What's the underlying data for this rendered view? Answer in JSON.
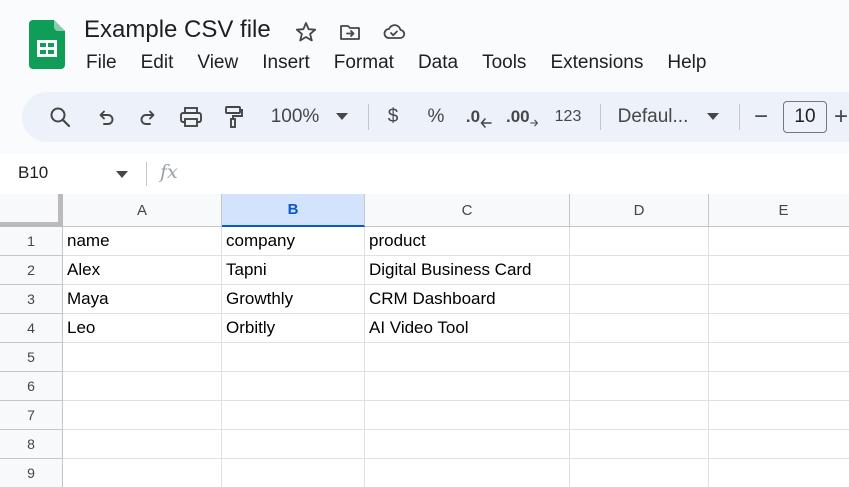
{
  "document": {
    "title": "Example CSV file"
  },
  "menu": [
    "File",
    "Edit",
    "View",
    "Insert",
    "Format",
    "Data",
    "Tools",
    "Extensions",
    "Help"
  ],
  "toolbar": {
    "zoom": "100%",
    "currency": "$",
    "percent": "%",
    "decrease_decimal": ".0",
    "increase_decimal": ".00",
    "number_format": "123",
    "font": "Defaul...",
    "font_size": "10",
    "minus": "−",
    "plus": "+"
  },
  "formula_bar": {
    "name_box": "B10",
    "fx": "fx"
  },
  "grid": {
    "columns": [
      "A",
      "B",
      "C",
      "D",
      "E"
    ],
    "selected_column": "B",
    "rows": [
      "1",
      "2",
      "3",
      "4",
      "5",
      "6",
      "7",
      "8",
      "9"
    ],
    "cells": [
      [
        "name",
        "company",
        "product",
        "",
        ""
      ],
      [
        "Alex",
        "Tapni",
        "Digital Business Card",
        "",
        ""
      ],
      [
        "Maya",
        "Growthly",
        "CRM Dashboard",
        "",
        ""
      ],
      [
        "Leo",
        "Orbitly",
        "AI Video Tool",
        "",
        ""
      ],
      [
        "",
        "",
        "",
        "",
        ""
      ],
      [
        "",
        "",
        "",
        "",
        ""
      ],
      [
        "",
        "",
        "",
        "",
        ""
      ],
      [
        "",
        "",
        "",
        "",
        ""
      ],
      [
        "",
        "",
        "",
        "",
        ""
      ]
    ]
  },
  "colors": {
    "brand_green": "#0f9d58",
    "selected_header_bg": "#d3e3fd",
    "selected_header_text": "#0b57d0",
    "toolbar_bg": "#edf2fa"
  },
  "icons": [
    "sheets-logo-icon",
    "star-icon",
    "move-to-folder-icon",
    "cloud-saved-icon",
    "search-icon",
    "undo-icon",
    "redo-icon",
    "print-icon",
    "paint-format-icon",
    "dropdown-caret-icon",
    "minus-icon",
    "plus-icon"
  ]
}
